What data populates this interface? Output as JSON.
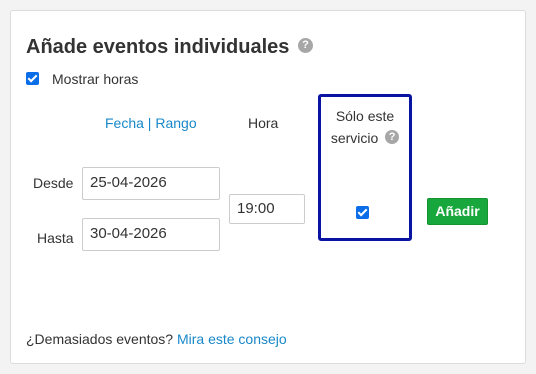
{
  "section": {
    "title": "Añade eventos individuales",
    "help_icon_glyph": "?"
  },
  "show_hours": {
    "label": "Mostrar horas",
    "checked": true
  },
  "columns": {
    "date_mode_fecha": "Fecha",
    "date_mode_separator": " | ",
    "date_mode_rango": "Rango",
    "hour_header": "Hora",
    "service_only_header": "Sólo este servicio"
  },
  "from": {
    "label": "Desde",
    "value": "25-04-2026"
  },
  "to": {
    "label": "Hasta",
    "value": "30-04-2026"
  },
  "hour": {
    "value": "19:00"
  },
  "service_only": {
    "checked": true
  },
  "add_button": {
    "label": "Añadir"
  },
  "tip": {
    "text": "¿Demasiados eventos? ",
    "link": "Mira este consejo"
  },
  "colors": {
    "link": "#1a88c8",
    "button": "#17a73c",
    "highlight_border": "#0a14a2",
    "checkbox": "#0b6ee8"
  }
}
